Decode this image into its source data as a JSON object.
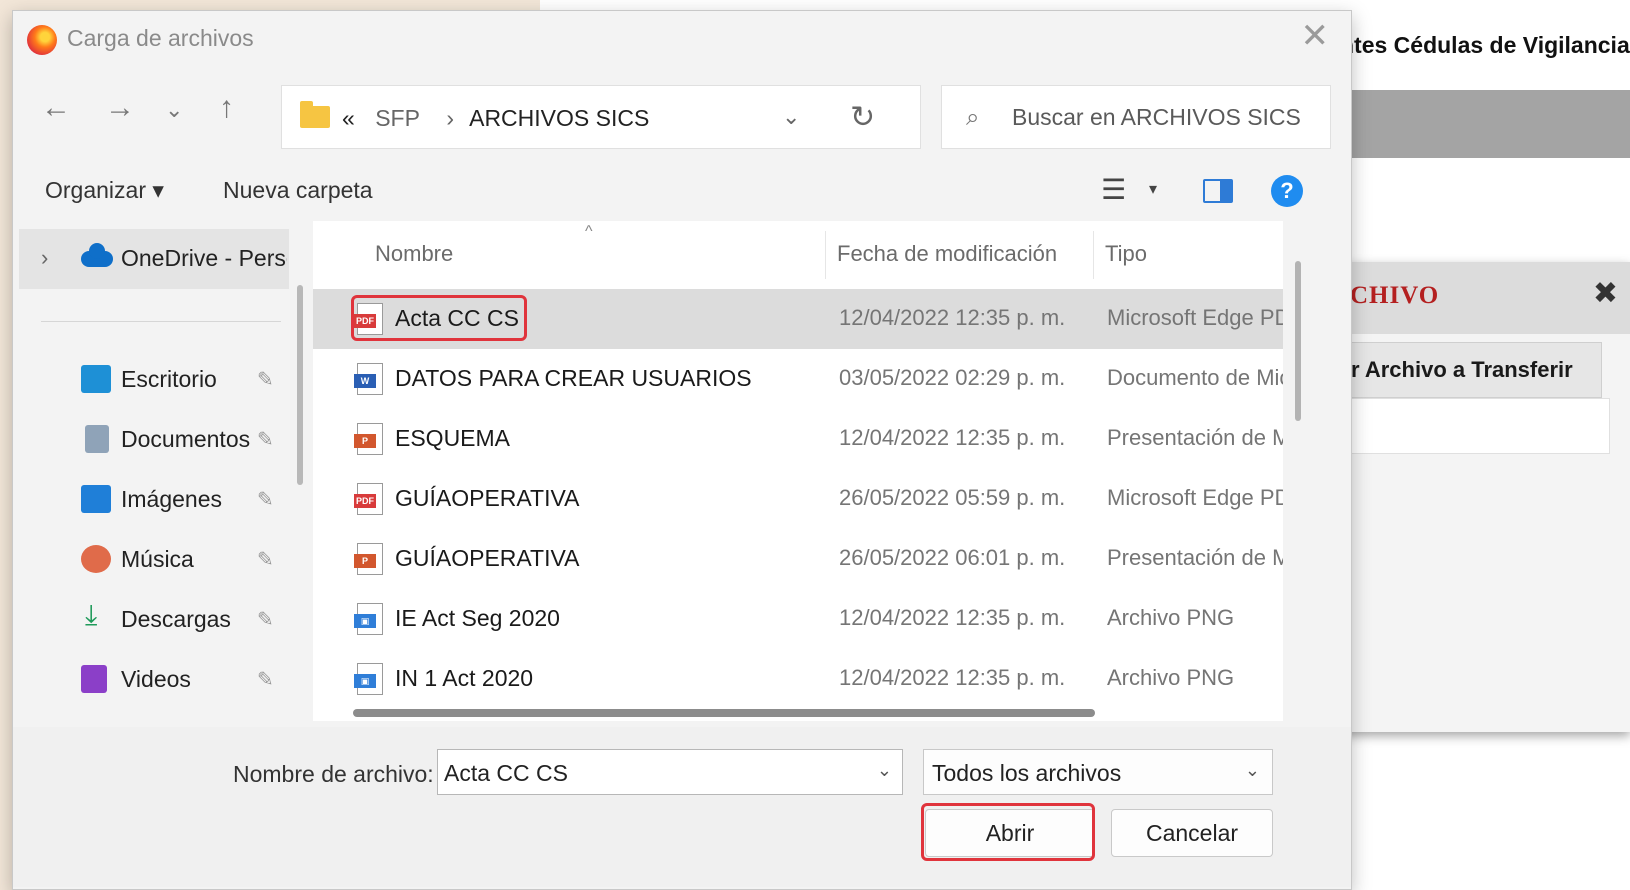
{
  "background_page": {
    "heading": "ntes Cédulas de Vigilancia",
    "modal_title": "CHIVO",
    "modal_close": "✖",
    "modal_button": "r Archivo a Transferir"
  },
  "dialog": {
    "title": "Carga de archivos",
    "close_glyph": "✕",
    "nav": {
      "back": "←",
      "forward": "→",
      "recent": "⌄",
      "up": "↑"
    },
    "address": {
      "prefix": "«",
      "crumbs": [
        "SFP",
        "ARCHIVOS SICS"
      ],
      "separator": "›",
      "dropdown": "⌄",
      "refresh": "↻"
    },
    "search": {
      "placeholder": "Buscar en ARCHIVOS SICS",
      "icon": "search-icon"
    },
    "toolbar": {
      "organize": "Organizar ▾",
      "new_folder": "Nueva carpeta",
      "view_glyph": "☰",
      "view_dd": "▾",
      "help": "?"
    },
    "sidebar": {
      "onedrive": "OneDrive - Perso",
      "items": [
        {
          "label": "Escritorio",
          "icon": "desktop-icon",
          "color": "#1e90d6"
        },
        {
          "label": "Documentos",
          "icon": "documents-icon",
          "color": "#8fa3b8"
        },
        {
          "label": "Imágenes",
          "icon": "pictures-icon",
          "color": "#1f7fd8"
        },
        {
          "label": "Música",
          "icon": "music-icon",
          "color": "#e06b4a"
        },
        {
          "label": "Descargas",
          "icon": "downloads-icon",
          "color": "#1f9a5a"
        },
        {
          "label": "Videos",
          "icon": "videos-icon",
          "color": "#8b3fc8"
        }
      ],
      "pin_glyph": "📌"
    },
    "columns": {
      "name": "Nombre",
      "modified": "Fecha de modificación",
      "type": "Tipo",
      "sort_glyph": "^"
    },
    "files": [
      {
        "name": "Acta CC CS",
        "date": "12/04/2022 12:35 p. m.",
        "type": "Microsoft Edge PDF",
        "icon": "pdf",
        "badge": "PDF",
        "color": "#d83b3b",
        "selected": true
      },
      {
        "name": "DATOS PARA CREAR USUARIOS",
        "date": "03/05/2022 02:29 p. m.",
        "type": "Documento de Microsoft",
        "icon": "word",
        "badge": "W",
        "color": "#2b5fb4"
      },
      {
        "name": "ESQUEMA",
        "date": "12/04/2022 12:35 p. m.",
        "type": "Presentación de Microsoft",
        "icon": "powerpoint",
        "badge": "P",
        "color": "#d2572e"
      },
      {
        "name": "GUÍAOPERATIVA",
        "date": "26/05/2022 05:59 p. m.",
        "type": "Microsoft Edge PDF",
        "icon": "pdf",
        "badge": "PDF",
        "color": "#d83b3b"
      },
      {
        "name": "GUÍAOPERATIVA",
        "date": "26/05/2022 06:01 p. m.",
        "type": "Presentación de Microsoft",
        "icon": "powerpoint",
        "badge": "P",
        "color": "#d2572e"
      },
      {
        "name": "IE Act Seg 2020",
        "date": "12/04/2022 12:35 p. m.",
        "type": "Archivo PNG",
        "icon": "image",
        "badge": "▣",
        "color": "#2f7ed8"
      },
      {
        "name": "IN 1 Act 2020",
        "date": "12/04/2022 12:35 p. m.",
        "type": "Archivo PNG",
        "icon": "image",
        "badge": "▣",
        "color": "#2f7ed8"
      }
    ],
    "filename": {
      "label": "Nombre de archivo:",
      "value": "Acta CC CS",
      "dropdown": "⌄"
    },
    "filetype": {
      "value": "Todos los archivos",
      "dropdown": "⌄"
    },
    "buttons": {
      "open": "Abrir",
      "cancel": "Cancelar"
    },
    "highlight_color": "#e0343c"
  }
}
